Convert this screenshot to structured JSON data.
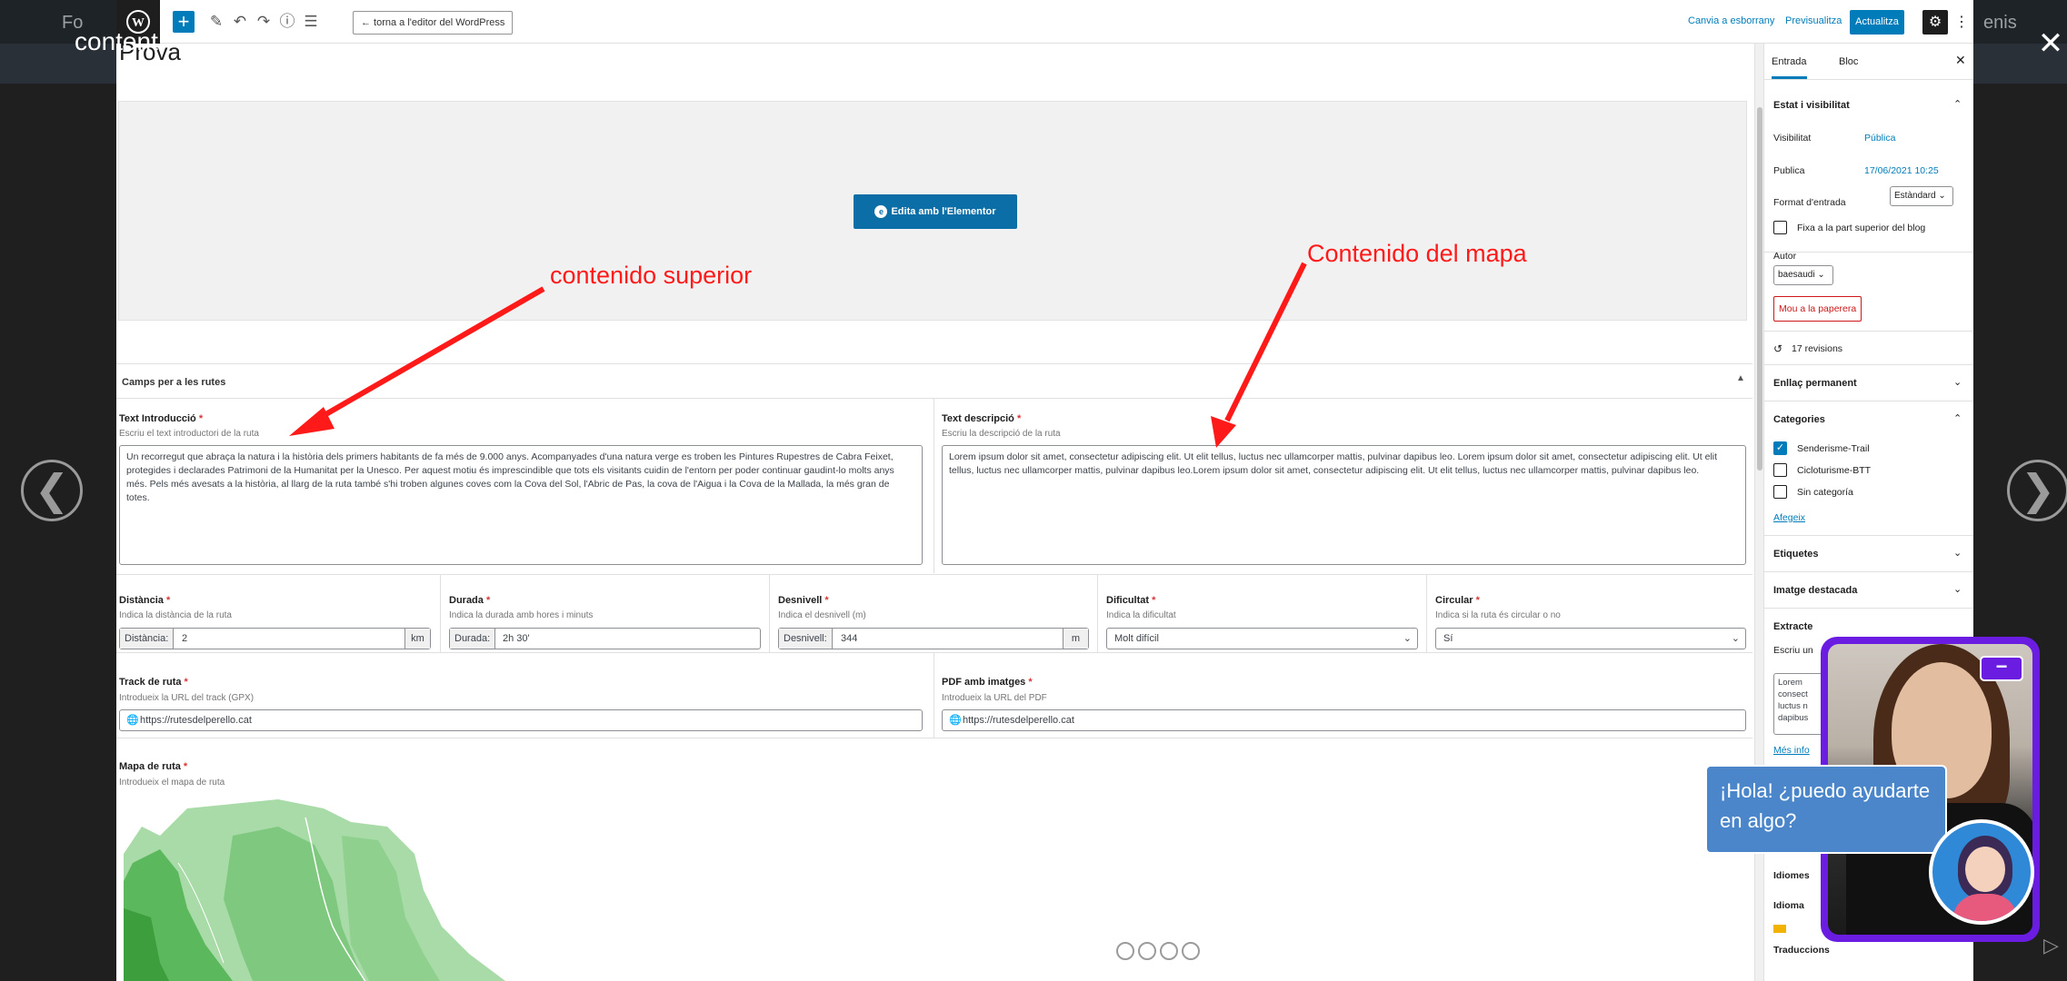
{
  "lightbox": {
    "title": "content",
    "close": "✕",
    "prev": "❮",
    "next": "❯",
    "bg_labels": [
      "Fo",
      "enis"
    ]
  },
  "toolbar": {
    "back_label": "← torna a l'editor del WordPress",
    "switch_draft": "Canvia a esborrany",
    "preview": "Previsualitza",
    "update": "Actualitza"
  },
  "post": {
    "title": "Prova",
    "elementor_button": "Edita amb l'Elementor"
  },
  "metabox": {
    "title": "Camps per a les rutes",
    "intro": {
      "label": "Text Introducció",
      "hint": "Escriu el text introductori de la ruta",
      "value": "Un recorregut que abraça la natura i la història dels primers habitants de fa més de 9.000 anys. Acompanyades d'una natura verge es troben les Pintures Rupestres de Cabra Feixet, protegides i declarades Patrimoni de la Humanitat per la Unesco. Per aquest motiu és imprescindible que tots els visitants cuidin de l'entorn per poder continuar gaudint-lo molts anys més. Pels més avesats a la història, al llarg de la ruta també s'hi troben algunes coves com la Cova del Sol, l'Abric de Pas, la cova de l'Aigua i la Cova de la Mallada, la més gran de totes."
    },
    "description": {
      "label": "Text descripció",
      "hint": "Escriu la descripció de la ruta",
      "value": "Lorem ipsum dolor sit amet, consectetur adipiscing elit. Ut elit tellus, luctus nec ullamcorper mattis, pulvinar dapibus leo. Lorem ipsum dolor sit amet, consectetur adipiscing elit. Ut elit tellus, luctus nec ullamcorper mattis, pulvinar dapibus leo.Lorem ipsum dolor sit amet, consectetur adipiscing elit. Ut elit tellus, luctus nec ullamcorper mattis, pulvinar dapibus leo."
    },
    "distance": {
      "label": "Distància",
      "hint": "Indica la distància de la ruta",
      "prefix": "Distància:",
      "value": "2",
      "suffix": "km"
    },
    "duration": {
      "label": "Durada",
      "hint": "Indica la durada amb hores i minuts",
      "prefix": "Durada:",
      "value": "2h 30'"
    },
    "elevation": {
      "label": "Desnivell",
      "hint": "Indica el desnivell (m)",
      "prefix": "Desnivell:",
      "value": "344",
      "suffix": "m"
    },
    "difficulty": {
      "label": "Dificultat",
      "hint": "Indica la dificultat",
      "value": "Molt difícil"
    },
    "circular": {
      "label": "Circular",
      "hint": "Indica si la ruta és circular o no",
      "value": "Sí"
    },
    "track": {
      "label": "Track de ruta",
      "hint": "Introdueix la URL del track (GPX)",
      "value": "https://rutesdelperello.cat"
    },
    "pdf": {
      "label": "PDF amb imatges",
      "hint": "Introdueix la URL del PDF",
      "value": "https://rutesdelperello.cat"
    },
    "map": {
      "label": "Mapa de ruta",
      "hint": "Introdueix el mapa de ruta"
    },
    "required_mark": "*"
  },
  "annotations": {
    "top": "contenido superior",
    "map": "Contenido del mapa"
  },
  "sidebar": {
    "tab_post": "Entrada",
    "tab_block": "Bloc",
    "close": "✕",
    "status_title": "Estat i visibilitat",
    "visibility_label": "Visibilitat",
    "visibility_value": "Pública",
    "publish_label": "Publica",
    "publish_value": "17/06/2021 10:25",
    "format_label": "Format d'entrada",
    "format_value": "Estàndard",
    "sticky_label": "Fixa a la part superior del blog",
    "author_label": "Autor",
    "author_value": "baesaudi",
    "trash_label": "Mou a la paperera",
    "revisions": "17 revisions",
    "permalink": "Enllaç permanent",
    "categories_title": "Categories",
    "categories": [
      {
        "label": "Senderisme-Trail",
        "checked": true
      },
      {
        "label": "Cicloturisme-BTT",
        "checked": false
      },
      {
        "label": "Sin categoría",
        "checked": false
      }
    ],
    "add_category": "Afegeix",
    "tags": "Etiquetes",
    "featured_image": "Imatge destacada",
    "excerpt": "Extracte",
    "excerpt_hint": "Escriu un",
    "excerpt_value": "Lorem consect luctus n dapibus",
    "more_info": "Més info",
    "languages": "Idiomes",
    "language_label": "Idioma",
    "translations": "Traduccions"
  },
  "chat": {
    "greeting": "¡Hola! ¿puedo ayudarte en algo?",
    "minimize": "−"
  }
}
